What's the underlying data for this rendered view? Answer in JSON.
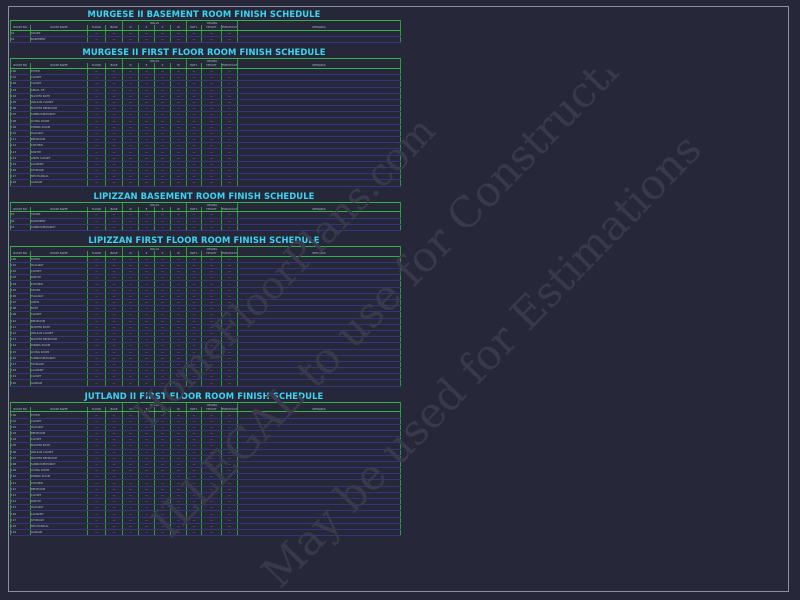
{
  "headers": {
    "room_no": "ROOM NO.",
    "room_name": "ROOM NAME",
    "floor": "FLOOR",
    "base": "BASE",
    "walls": "WALLS",
    "wall_n": "N",
    "wall_e": "E",
    "wall_s": "S",
    "wall_w": "W",
    "ceiling": "CEILING",
    "matl": "MAT'L",
    "height": "HEIGHT",
    "finish": "FINISH/COT",
    "remarks": "REMARKS",
    "dash": "—"
  },
  "schedules": [
    {
      "title": "MURGESE II BASEMENT ROOM FINISH SCHEDULE",
      "rooms": [
        {
          "no": "01",
          "name": "STAIRS"
        },
        {
          "no": "02",
          "name": "BASEMENT"
        }
      ]
    },
    {
      "title": "MURGESE II FIRST FLOOR ROOM FINISH SCHEDULE",
      "rooms": [
        {
          "no": "100",
          "name": "FOYER"
        },
        {
          "no": "101",
          "name": "CLOSET"
        },
        {
          "no": "102",
          "name": "CLOSET"
        },
        {
          "no": "103",
          "name": "SMALL OF."
        },
        {
          "no": "104",
          "name": "MASTER BATH"
        },
        {
          "no": "105",
          "name": "WALK-IN CLOSET"
        },
        {
          "no": "106",
          "name": "MASTER BEDROOM"
        },
        {
          "no": "107",
          "name": "SUNROOM/PORCH"
        },
        {
          "no": "108",
          "name": "LIVING ROOM"
        },
        {
          "no": "109",
          "name": "DINING ROOM"
        },
        {
          "no": "110",
          "name": "HALLWAY"
        },
        {
          "no": "111",
          "name": "BEDROOM"
        },
        {
          "no": "112",
          "name": "KITCHEN"
        },
        {
          "no": "113",
          "name": "PANTRY"
        },
        {
          "no": "114",
          "name": "LINEN CLOSET"
        },
        {
          "no": "115",
          "name": "LAUNDRY"
        },
        {
          "no": "116",
          "name": "STORAGE"
        },
        {
          "no": "117",
          "name": "MECHANICAL"
        },
        {
          "no": "118",
          "name": "GARAGE"
        }
      ]
    },
    {
      "title": "LIPIZZAN BASEMENT ROOM FINISH SCHEDULE",
      "rooms": [
        {
          "no": "01",
          "name": "STAIRS"
        },
        {
          "no": "02",
          "name": "BASEMENT"
        },
        {
          "no": "03",
          "name": "SUNROOM/PORCH"
        }
      ]
    },
    {
      "title": "LIPIZZAN FIRST FLOOR ROOM FINISH SCHEDULE",
      "rooms": [
        {
          "no": "100",
          "name": "FOYER"
        },
        {
          "no": "101",
          "name": "HALLWAY"
        },
        {
          "no": "102",
          "name": "CLOSET"
        },
        {
          "no": "103",
          "name": "PANTRY"
        },
        {
          "no": "104",
          "name": "KITCHEN"
        },
        {
          "no": "105",
          "name": "STAIRS"
        },
        {
          "no": "106",
          "name": "HALLWAY"
        },
        {
          "no": "107",
          "name": "LINEN"
        },
        {
          "no": "108",
          "name": "BATH"
        },
        {
          "no": "109",
          "name": "CLOSET"
        },
        {
          "no": "110",
          "name": "BEDROOM"
        },
        {
          "no": "111",
          "name": "MASTER BATH"
        },
        {
          "no": "112",
          "name": "WALK-IN CLOSET"
        },
        {
          "no": "113",
          "name": "MASTER BEDROOM"
        },
        {
          "no": "114",
          "name": "DINING ROOM"
        },
        {
          "no": "115",
          "name": "LIVING ROOM"
        },
        {
          "no": "116",
          "name": "SUNROOM/PORCH"
        },
        {
          "no": "117",
          "name": "STORAGE"
        },
        {
          "no": "118",
          "name": "LAUNDRY"
        },
        {
          "no": "119",
          "name": "CLOSET"
        },
        {
          "no": "120",
          "name": "GARAGE"
        }
      ]
    },
    {
      "title": "JUTLAND II FIRST FLOOR ROOM FINISH SCHEDULE",
      "rooms": [
        {
          "no": "100",
          "name": "FOYER"
        },
        {
          "no": "101",
          "name": "CLOSET"
        },
        {
          "no": "102",
          "name": "HALLWAY"
        },
        {
          "no": "103",
          "name": "BEDROOM"
        },
        {
          "no": "104",
          "name": "CLOSET"
        },
        {
          "no": "105",
          "name": "MASTER BATH"
        },
        {
          "no": "106",
          "name": "WALK-IN CLOSET"
        },
        {
          "no": "107",
          "name": "MASTER BEDROOM"
        },
        {
          "no": "108",
          "name": "SUNROOM/PORCH"
        },
        {
          "no": "109",
          "name": "LIVING ROOM"
        },
        {
          "no": "110",
          "name": "DINING ROOM"
        },
        {
          "no": "111",
          "name": "KITCHEN"
        },
        {
          "no": "112",
          "name": "BEDROOM"
        },
        {
          "no": "113",
          "name": "CLOSET"
        },
        {
          "no": "114",
          "name": "PANTRY"
        },
        {
          "no": "115",
          "name": "HALLWAY"
        },
        {
          "no": "116",
          "name": "LAUNDRY"
        },
        {
          "no": "117",
          "name": "STORAGE"
        },
        {
          "no": "118",
          "name": "MECHANICAL"
        },
        {
          "no": "119",
          "name": "GARAGE"
        }
      ]
    }
  ],
  "watermark": {
    "line1": "ILLEGAL to use for Construction",
    "line2": "May be used for Estimations",
    "line3": "HomeFloorPlans.com"
  },
  "colors": {
    "background": "#262738",
    "title": "#39d6f2",
    "grid": "#2f9c3c",
    "row_line": "#33357f",
    "text": "#b4b7d0"
  }
}
